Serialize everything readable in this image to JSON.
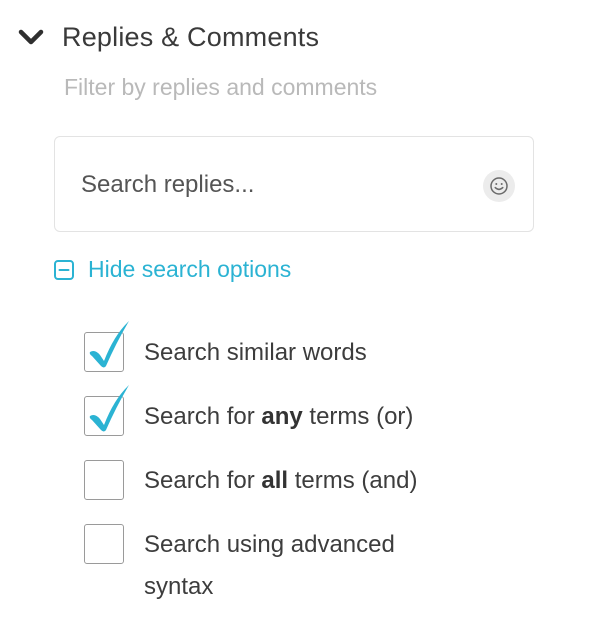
{
  "section": {
    "title": "Replies & Comments",
    "subtitle": "Filter by replies and comments",
    "chevron_icon": "chevron-down-icon"
  },
  "search": {
    "placeholder": "Search replies...",
    "value": "",
    "emoji_icon": "smiley-icon"
  },
  "search_options_toggle": {
    "label": "Hide search options",
    "icon": "collapse-minus-icon"
  },
  "options": [
    {
      "id": "similar",
      "pre": "Search similar words",
      "bold": "",
      "post": "",
      "checked": true
    },
    {
      "id": "any",
      "pre": "Search for ",
      "bold": "any",
      "post": " terms (or)",
      "checked": true
    },
    {
      "id": "all",
      "pre": "Search for ",
      "bold": "all",
      "post": " terms (and)",
      "checked": false
    },
    {
      "id": "advanced",
      "pre": "Search using advanced syntax",
      "bold": "",
      "post": "",
      "checked": false
    }
  ],
  "colors": {
    "accent": "#2bb3d3",
    "text": "#3d3d3d",
    "muted": "#b9b9b9",
    "border": "#e3e3e3"
  }
}
